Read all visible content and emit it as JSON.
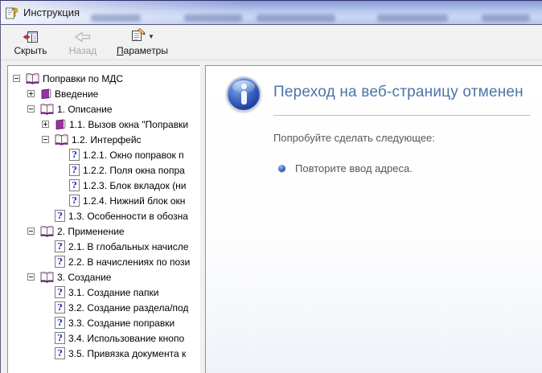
{
  "window": {
    "title": "Инструкция"
  },
  "toolbar": {
    "buttons": [
      {
        "label": "Скрыть",
        "enabled": true,
        "icon": "hide-pane-icon"
      },
      {
        "label": "Назад",
        "enabled": false,
        "icon": "back-arrow-icon"
      },
      {
        "label": "Параметры",
        "enabled": true,
        "icon": "options-page-icon",
        "has_dropdown": true
      }
    ]
  },
  "tree": {
    "items": [
      {
        "level": 0,
        "type": "book-open",
        "expander": "minus",
        "label": "Поправки по МДС"
      },
      {
        "level": 1,
        "type": "book-closed",
        "expander": "plus",
        "label": "Введение"
      },
      {
        "level": 1,
        "type": "book-open",
        "expander": "minus",
        "label": "1. Описание"
      },
      {
        "level": 2,
        "type": "book-closed",
        "expander": "plus",
        "label": "1.1. Вызов окна \"Поправки"
      },
      {
        "level": 2,
        "type": "book-open",
        "expander": "minus",
        "label": "1.2. Интерфейс"
      },
      {
        "level": 3,
        "type": "topic",
        "expander": null,
        "label": "1.2.1. Окно поправок п"
      },
      {
        "level": 3,
        "type": "topic",
        "expander": null,
        "label": "1.2.2. Поля окна попра"
      },
      {
        "level": 3,
        "type": "topic",
        "expander": null,
        "label": "1.2.3. Блок вкладок (ни"
      },
      {
        "level": 3,
        "type": "topic",
        "expander": null,
        "label": "1.2.4. Нижний блок окн"
      },
      {
        "level": 2,
        "type": "topic",
        "expander": null,
        "label": "1.3. Особенности в обозна"
      },
      {
        "level": 1,
        "type": "book-open",
        "expander": "minus",
        "label": "2. Применение"
      },
      {
        "level": 2,
        "type": "topic",
        "expander": null,
        "label": "2.1. В глобальных начисле"
      },
      {
        "level": 2,
        "type": "topic",
        "expander": null,
        "label": "2.2. В начислениях по пози"
      },
      {
        "level": 1,
        "type": "book-open",
        "expander": "minus",
        "label": "3. Создание"
      },
      {
        "level": 2,
        "type": "topic",
        "expander": null,
        "label": "3.1. Создание папки"
      },
      {
        "level": 2,
        "type": "topic",
        "expander": null,
        "label": "3.2. Создание раздела/под"
      },
      {
        "level": 2,
        "type": "topic",
        "expander": null,
        "label": "3.3. Создание поправки"
      },
      {
        "level": 2,
        "type": "topic",
        "expander": null,
        "label": "3.4. Использование кнопо"
      },
      {
        "level": 2,
        "type": "topic",
        "expander": null,
        "label": "3.5. Привязка документа к"
      }
    ]
  },
  "content": {
    "heading": "Переход на веб-страницу отменен",
    "intro": "Попробуйте сделать следующее:",
    "bullets": [
      "Повторите ввод адреса."
    ]
  },
  "colors": {
    "titlebar_blue": "#9fb1e2",
    "heading_blue": "#4b74a8",
    "info_icon_blue": "#2a57b8",
    "book_purple": "#9b30a0",
    "topic_question_blue": "#2030c0",
    "disabled_label_gray": "#a6a6a6",
    "body_text_gray": "#57575a"
  }
}
